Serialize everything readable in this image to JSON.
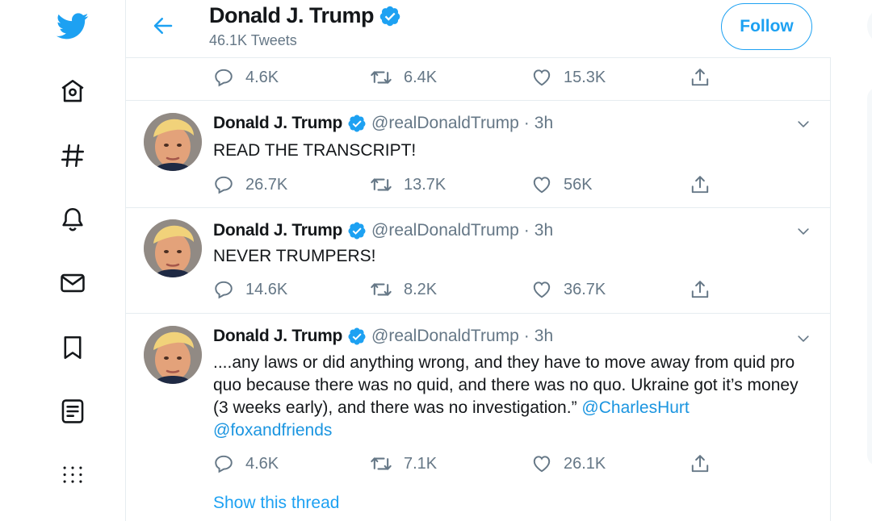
{
  "nav": {
    "icons": [
      "twitter-bird-icon",
      "home-icon",
      "hashtag-icon",
      "notifications-bell-icon",
      "messages-envelope-icon",
      "bookmark-icon",
      "lists-icon",
      "more-icon"
    ]
  },
  "header": {
    "name": "Donald J. Trump",
    "tweet_count": "46.1K Tweets",
    "follow_label": "Follow"
  },
  "colors": {
    "brand_blue": "#1da1f2",
    "link_blue": "#1b95e0",
    "secondary_text": "#657786",
    "border": "#e6ecf0"
  },
  "tweets": [
    {
      "reply": "4.6K",
      "retweet": "6.4K",
      "like": "15.3K"
    },
    {
      "name": "Donald J. Trump",
      "handle": "@realDonaldTrump",
      "dot": "·",
      "time": "3h",
      "text": "READ THE TRANSCRIPT!",
      "reply": "26.7K",
      "retweet": "13.7K",
      "like": "56K"
    },
    {
      "name": "Donald J. Trump",
      "handle": "@realDonaldTrump",
      "dot": "·",
      "time": "3h",
      "text": "NEVER TRUMPERS!",
      "reply": "14.6K",
      "retweet": "8.2K",
      "like": "36.7K"
    },
    {
      "name": "Donald J. Trump",
      "handle": "@realDonaldTrump",
      "dot": "·",
      "time": "3h",
      "text": "....any laws or did anything wrong, and they have to move away from quid pro quo because there was no quid, and there was no quo. Ukraine got it’s money (3 weeks early), and there was no investigation.”",
      "mention1": "@CharlesHurt",
      "mention2": "@foxandfriends",
      "reply": "4.6K",
      "retweet": "7.1K",
      "like": "26.1K",
      "show_thread": "Show this thread"
    }
  ]
}
